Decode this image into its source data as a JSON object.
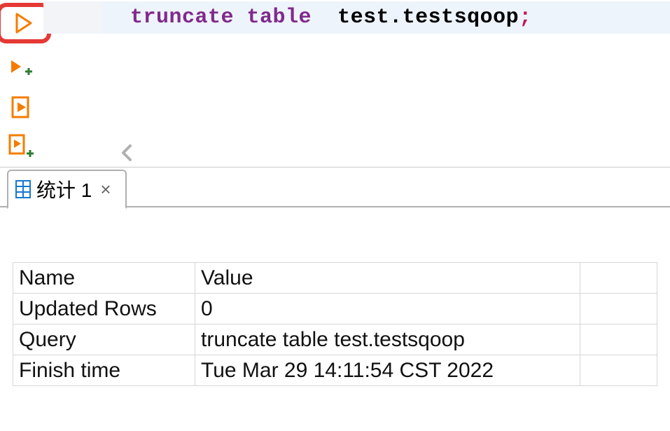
{
  "editor": {
    "sql_keyword1": "truncate",
    "sql_keyword2": "table",
    "sql_object": "test.testsqoop",
    "sql_terminator": ";"
  },
  "toolbar": {
    "run": "run",
    "run_new": "run-new",
    "explain": "explain-plan",
    "explain_new": "explain-plan-new"
  },
  "tab": {
    "label": "统计 1"
  },
  "results": {
    "headers": {
      "name": "Name",
      "value": "Value"
    },
    "rows": [
      {
        "name": "Updated Rows",
        "value": "0"
      },
      {
        "name": "Query",
        "value": "truncate table  test.testsqoop"
      },
      {
        "name": "Finish time",
        "value": "Tue Mar 29 14:11:54 CST 2022"
      }
    ]
  }
}
